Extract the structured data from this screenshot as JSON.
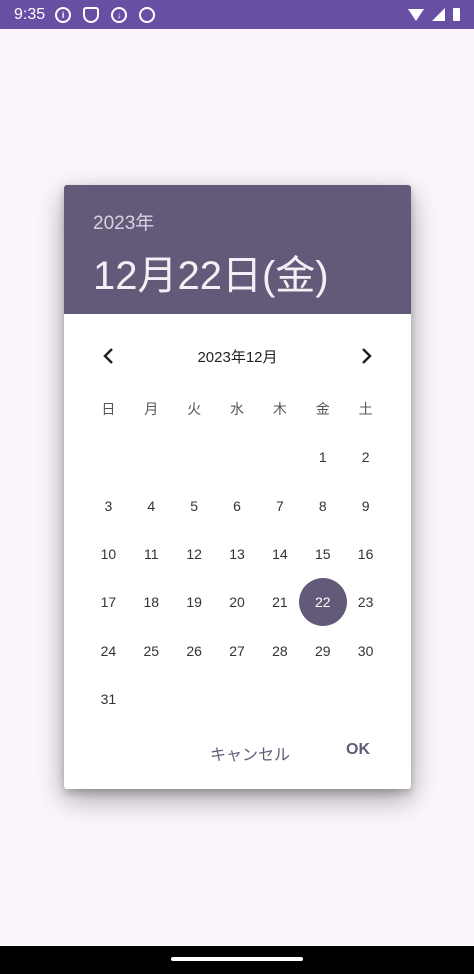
{
  "status_bar": {
    "time": "9:35",
    "icons": [
      "info-icon",
      "shield-icon",
      "download-icon",
      "app-icon"
    ],
    "right_icons": [
      "wifi-icon",
      "signal-icon",
      "battery-icon"
    ]
  },
  "dialog": {
    "year": "2023年",
    "date": "12月22日(金)",
    "month_label": "2023年12月",
    "weekdays": [
      "日",
      "月",
      "火",
      "水",
      "木",
      "金",
      "土"
    ],
    "weeks": [
      [
        "",
        "",
        "",
        "",
        "",
        "1",
        "2"
      ],
      [
        "3",
        "4",
        "5",
        "6",
        "7",
        "8",
        "9"
      ],
      [
        "10",
        "11",
        "12",
        "13",
        "14",
        "15",
        "16"
      ],
      [
        "17",
        "18",
        "19",
        "20",
        "21",
        "22",
        "23"
      ],
      [
        "24",
        "25",
        "26",
        "27",
        "28",
        "29",
        "30"
      ],
      [
        "31",
        "",
        "",
        "",
        "",
        "",
        ""
      ]
    ],
    "selected_day": "22",
    "cancel_label": "キャンセル",
    "ok_label": "OK"
  },
  "colors": {
    "status_bar": "#6750a4",
    "header": "#625a78",
    "accent": "#625a78",
    "background": "#fcf6fc"
  }
}
